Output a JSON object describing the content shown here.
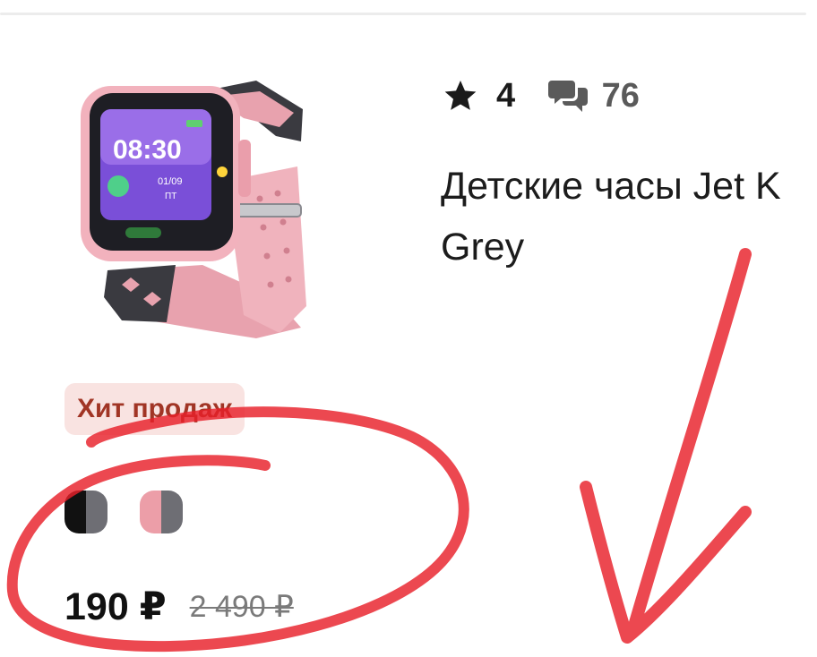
{
  "product": {
    "rating": "4",
    "reviews_count": "76",
    "title_line1": "Детские часы Jet K",
    "title_line2": "Grey",
    "badge": "Хит продаж",
    "price_current": "190 ₽",
    "price_old": "2 490 ₽",
    "swatches": [
      {
        "name": "black",
        "left_color": "#111111",
        "right_color": "#6e6e74"
      },
      {
        "name": "pink",
        "left_color": "#ec9ea8",
        "right_color": "#6e6e74"
      }
    ]
  },
  "icons": {
    "rating": "star-icon",
    "reviews": "chat-bubbles-icon"
  },
  "colors": {
    "annotation": "#e8202a",
    "badge_bg": "#f9e3e1",
    "badge_text": "#a13525"
  }
}
